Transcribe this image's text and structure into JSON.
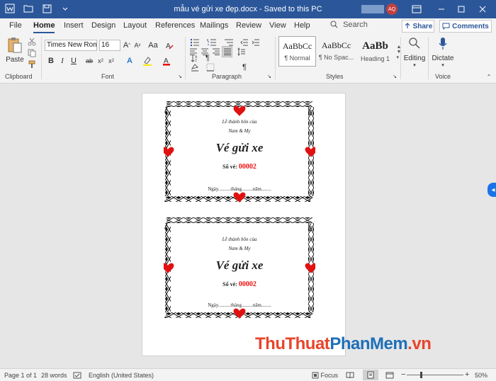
{
  "window": {
    "title": "mẫu vé gửi xe đẹp.docx  -  Saved to this PC",
    "user_initials": "AQ"
  },
  "tabs": [
    "File",
    "Home",
    "Insert",
    "Design",
    "Layout",
    "References",
    "Mailings",
    "Review",
    "View",
    "Help"
  ],
  "search_label": "Search",
  "share_label": "Share",
  "comments_label": "Comments",
  "ribbon": {
    "clipboard": {
      "paste_label": "Paste",
      "group_label": "Clipboard"
    },
    "font": {
      "family": "Times New Roman",
      "size": "16",
      "group_label": "Font"
    },
    "paragraph": {
      "group_label": "Paragraph"
    },
    "styles": {
      "group_label": "Styles",
      "items": [
        {
          "sample": "AaBbCc",
          "name": "¶ Normal"
        },
        {
          "sample": "AaBbCc",
          "name": "¶ No Spac..."
        },
        {
          "sample": "AaBb",
          "name": "Heading 1"
        }
      ]
    },
    "editing_label": "Editing",
    "dictate_label": "Dictate",
    "voice_group_label": "Voice"
  },
  "tickets": [
    {
      "intro_line1": "Lễ thành hôn của",
      "intro_line2": "Nam & My",
      "title": "Vé gửi xe",
      "number_label": "Số vé:",
      "number": "00002",
      "date_line": "Ngày..........tháng.........năm........"
    },
    {
      "intro_line1": "Lễ thành hôn của",
      "intro_line2": "Nam & My",
      "title": "Vé gửi xe",
      "number_label": "Số vé:",
      "number": "00002",
      "date_line": "Ngày..........tháng.........năm........"
    }
  ],
  "status": {
    "page": "Page 1 of 1",
    "words": "28 words",
    "language": "English (United States)",
    "focus": "Focus",
    "zoom": "50%"
  },
  "watermark": {
    "part1": "ThuThuat",
    "part2": "PhanMem",
    "part3": ".vn"
  },
  "colors": {
    "titlebar": "#2b579a",
    "heart": "#e11111",
    "ticket_number": "#e11111"
  }
}
